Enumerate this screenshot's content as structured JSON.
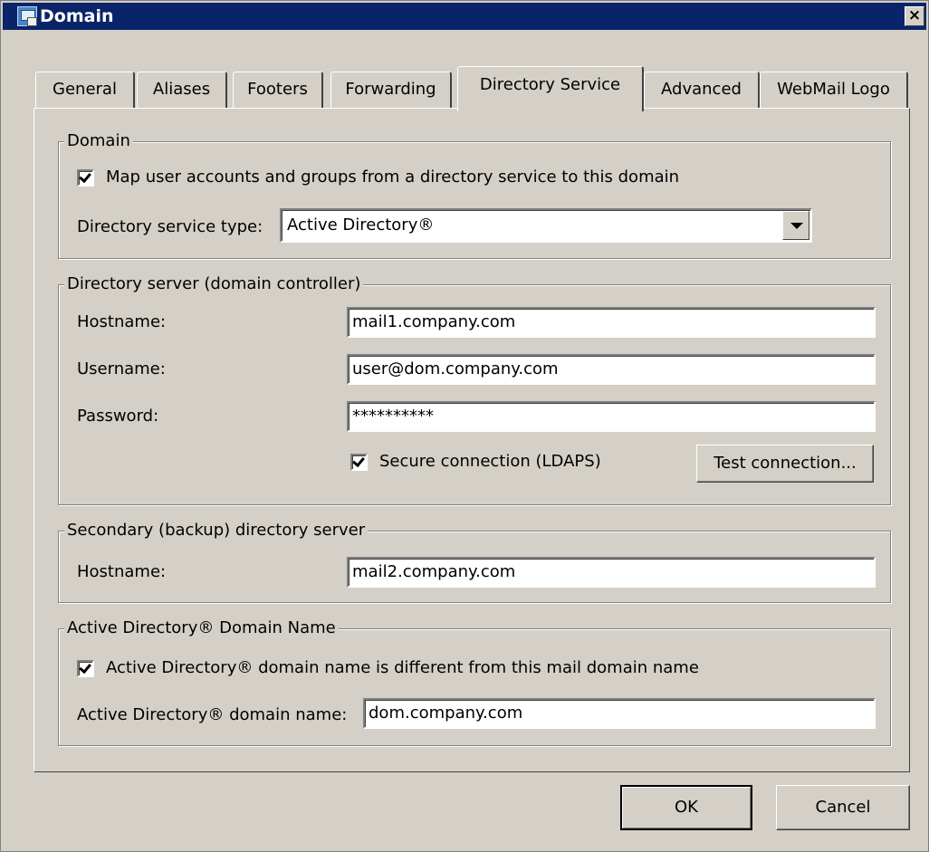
{
  "window": {
    "title": "Domain",
    "close_label": "×"
  },
  "tabs": [
    {
      "label": "General"
    },
    {
      "label": "Aliases"
    },
    {
      "label": "Footers"
    },
    {
      "label": "Forwarding"
    },
    {
      "label": "Directory Service",
      "active": true
    },
    {
      "label": "Advanced"
    },
    {
      "label": "WebMail Logo"
    }
  ],
  "domain_group": {
    "title": "Domain",
    "map_checkbox_label": "Map user accounts and groups from a directory service to this domain",
    "map_checked": true,
    "type_label": "Directory service type:",
    "type_value": "Active Directory®"
  },
  "server_group": {
    "title": "Directory server (domain controller)",
    "hostname_label": "Hostname:",
    "hostname_value": "mail1.company.com",
    "username_label": "Username:",
    "username_value": "user@dom.company.com",
    "password_label": "Password:",
    "password_value": "**********",
    "secure_label": "Secure connection (LDAPS)",
    "secure_checked": true,
    "test_button": "Test connection..."
  },
  "secondary_group": {
    "title": "Secondary (backup) directory server",
    "hostname_label": "Hostname:",
    "hostname_value": "mail2.company.com"
  },
  "ad_group": {
    "title": "Active Directory® Domain Name",
    "different_label": "Active Directory® domain name is different from this mail domain name",
    "different_checked": true,
    "name_label": "Active Directory® domain name:",
    "name_value": "dom.company.com"
  },
  "buttons": {
    "ok": "OK",
    "cancel": "Cancel"
  }
}
